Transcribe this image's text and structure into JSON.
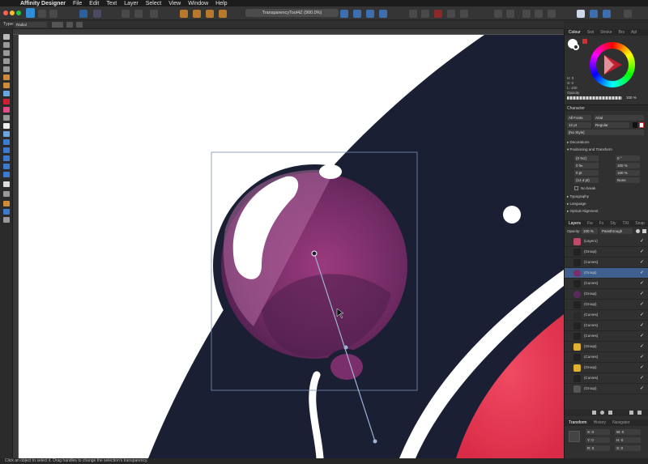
{
  "menubar": {
    "apple": "",
    "app_name": "Affinity Designer",
    "items": [
      "File",
      "Edit",
      "Text",
      "Layer",
      "Select",
      "View",
      "Window",
      "Help"
    ]
  },
  "toolbar": {
    "document_title": "TransparencyTool4Z (900.0%)"
  },
  "context_toolbar": {
    "type_label": "Type:",
    "type_value": "Radial"
  },
  "colour_panel": {
    "tabs": [
      "Colour",
      "Swt",
      "Stroke",
      "Brs",
      "Apl"
    ],
    "hsl": [
      "H: 0",
      "S: 0",
      "L: 100"
    ],
    "opacity_label": "Opacity",
    "opacity_value": "100 %"
  },
  "character_panel": {
    "title": "Character",
    "font_collection": "All Fonts",
    "font_family": "Arial",
    "font_size": "12 pt",
    "font_style": "Regular",
    "style": "[No Style]",
    "sections": [
      "Decorations",
      "Positioning and Transform"
    ],
    "fields": [
      "(0 %z)",
      "0 °",
      "0 ‰",
      "100 %",
      "0 pt",
      "100 %",
      "(12.4 pt)",
      "None"
    ],
    "no_break": "No break",
    "sections_after": [
      "Typography",
      "Language",
      "Optical Alignment"
    ]
  },
  "layers_panel": {
    "tabs": [
      "Layers",
      "Fw",
      "Fx",
      "Sty",
      "TXt",
      "Snap"
    ],
    "opacity_label": "Opacity:",
    "opacity_value": "100 %",
    "blend_mode": "Passthrough",
    "rows": [
      {
        "name": "(Layer1)",
        "selected": false
      },
      {
        "name": "(Group)",
        "selected": false
      },
      {
        "name": "(Curves)",
        "selected": false
      },
      {
        "name": "(Group)",
        "selected": true
      },
      {
        "name": "(Curves)",
        "selected": false
      },
      {
        "name": "(Group)",
        "selected": false
      },
      {
        "name": "(Group)",
        "selected": false
      },
      {
        "name": "(Curves)",
        "selected": false
      },
      {
        "name": "(Curves)",
        "selected": false
      },
      {
        "name": "(Curves)",
        "selected": false
      },
      {
        "name": "(Group)",
        "selected": false
      },
      {
        "name": "(Curves)",
        "selected": false
      },
      {
        "name": "(Group)",
        "selected": false
      },
      {
        "name": "(Curves)",
        "selected": false
      },
      {
        "name": "(Group)",
        "selected": false
      }
    ]
  },
  "transform_panel": {
    "tabs": [
      "Transform",
      "History",
      "Navigator"
    ],
    "fields": [
      "X: 0",
      "W: 0",
      "Y: 0",
      "H: 0",
      "R: 0",
      "S: 0"
    ]
  },
  "statusbar": {
    "text": "Click an object to select it. Drag handles to change the selection's transparency."
  },
  "colors": {
    "navy": "#1a1f33",
    "balloon_purple": "#7a2f6a",
    "red_planet": "#e8344f",
    "selection_blue": "#3f5f8f"
  }
}
